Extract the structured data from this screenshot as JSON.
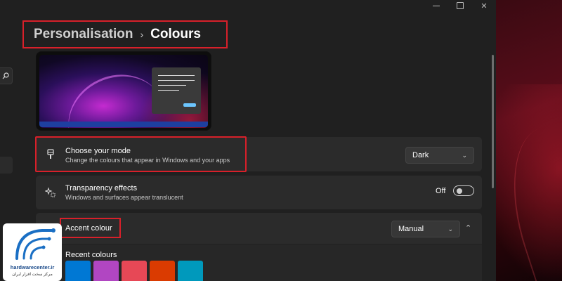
{
  "breadcrumb": {
    "parent": "Personalisation",
    "separator": "›",
    "current": "Colours"
  },
  "mode": {
    "title": "Choose your mode",
    "subtitle": "Change the colours that appear in Windows and your apps",
    "icon": "paintbrush-icon",
    "selected": "Dark"
  },
  "transparency": {
    "title": "Transparency effects",
    "subtitle": "Windows and surfaces appear translucent",
    "icon": "sparkle-icon",
    "state_label": "Off",
    "enabled": false
  },
  "accent": {
    "title": "Accent colour",
    "icon": "palette-icon",
    "selected": "Manual"
  },
  "recent_colours": {
    "label": "Recent colours",
    "swatches": [
      "#0078d4",
      "#b146c2",
      "#e74856",
      "#da3b01",
      "#0099bc"
    ]
  },
  "watermark": {
    "brand": "hardwarecenter.ir",
    "tagline": "مرکز سخت افزار ایران"
  },
  "colors": {
    "highlight": "#d8202a",
    "window_bg": "#202020",
    "card_bg": "#2b2b2b"
  }
}
